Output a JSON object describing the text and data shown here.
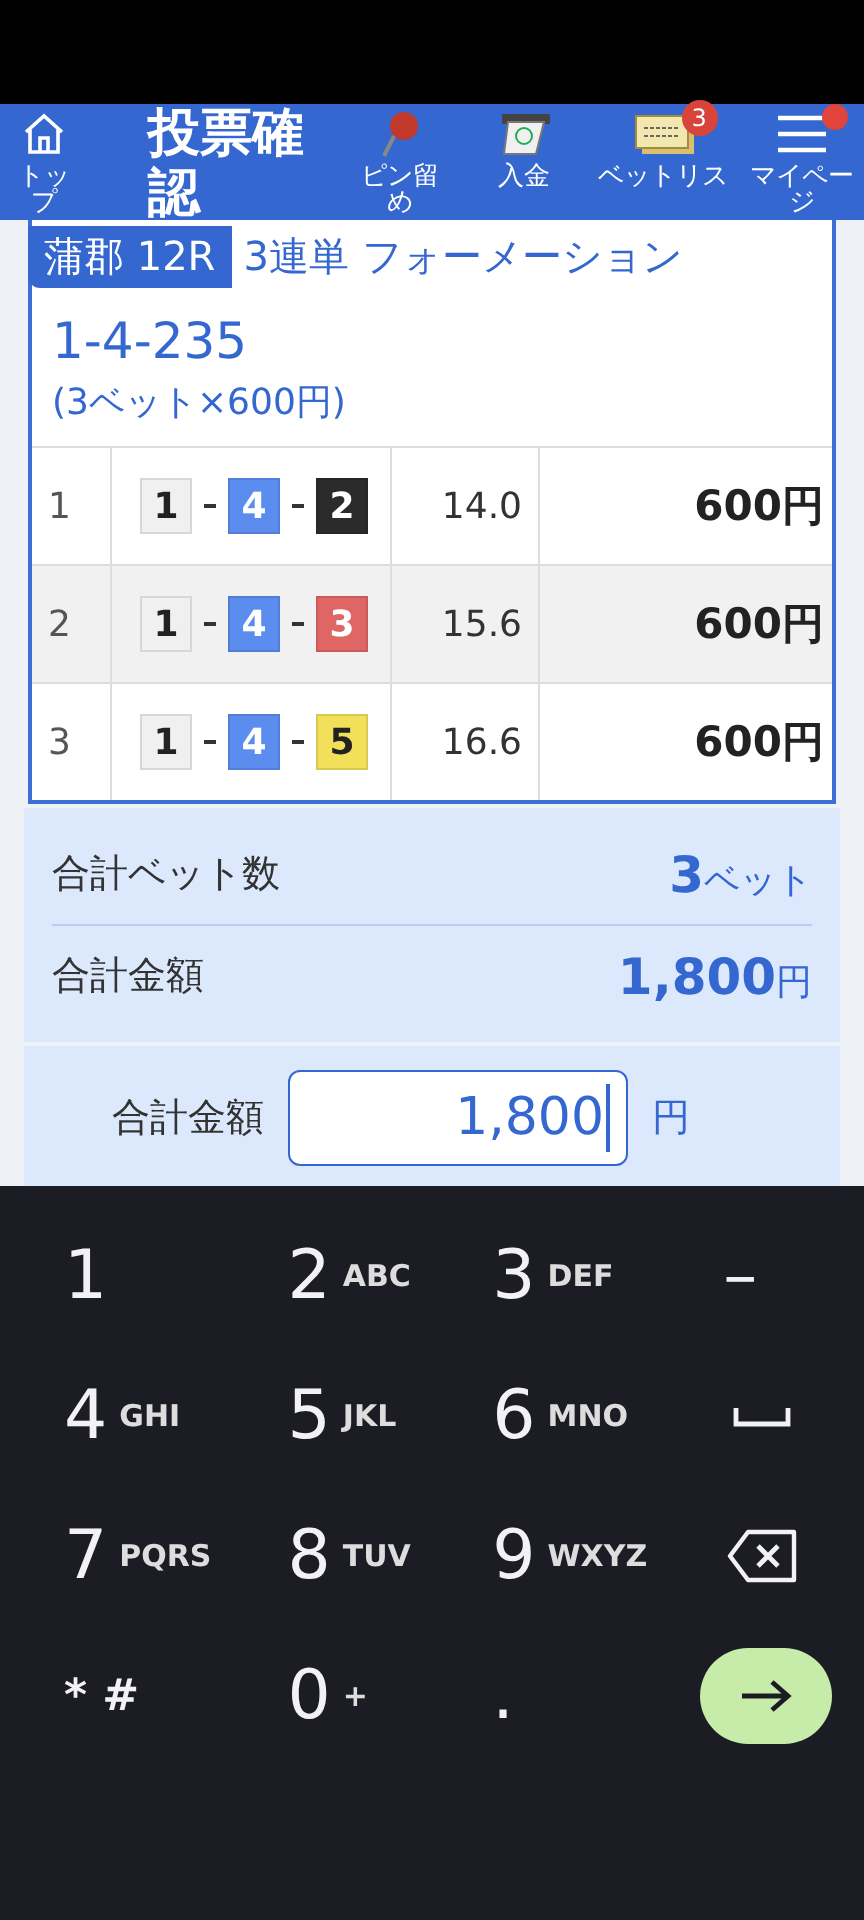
{
  "header": {
    "nav": [
      {
        "kind": "home",
        "label": "トップ"
      },
      {
        "kind": "title",
        "label": "投票確認"
      },
      {
        "kind": "pin",
        "label": "ピン留め"
      },
      {
        "kind": "deposit",
        "label": "入金"
      },
      {
        "kind": "betlist",
        "label": "ベットリス",
        "badge": "3"
      },
      {
        "kind": "menu",
        "label": "マイページ",
        "alert": true
      }
    ]
  },
  "ticket": {
    "venue": "蒲郡 12R",
    "bet_type": "3連単 フォーメーション",
    "combination": "1-4-235",
    "summary": "(3ベット×600円)",
    "rows": [
      {
        "index": "1",
        "boats": [
          {
            "number": "1",
            "color": "#f0f0f0"
          },
          {
            "number": "4",
            "color": "#5b8def"
          },
          {
            "number": "2",
            "color": "#2b2b2b"
          }
        ],
        "odds": "14.0",
        "amount": "600円"
      },
      {
        "index": "2",
        "boats": [
          {
            "number": "1",
            "color": "#f0f0f0"
          },
          {
            "number": "4",
            "color": "#5b8def"
          },
          {
            "number": "3",
            "color": "#e06666"
          }
        ],
        "odds": "15.6",
        "amount": "600円"
      },
      {
        "index": "3",
        "boats": [
          {
            "number": "1",
            "color": "#f0f0f0"
          },
          {
            "number": "4",
            "color": "#5b8def"
          },
          {
            "number": "5",
            "color": "#f2e05a"
          }
        ],
        "odds": "16.6",
        "amount": "600円"
      }
    ]
  },
  "totals": {
    "bet_count_label": "合計ベット数",
    "bet_count": "3",
    "bet_count_unit": "ベット",
    "total_label": "合計金額",
    "total": "1,800",
    "total_unit": "円"
  },
  "amount_input": {
    "label": "合計金額",
    "value": "1,800",
    "unit": "円"
  },
  "keyboard": {
    "keys": [
      {
        "kind": "digit",
        "main": "1"
      },
      {
        "kind": "digit",
        "main": "2",
        "sub": "ABC"
      },
      {
        "kind": "digit",
        "main": "3",
        "sub": "DEF"
      },
      {
        "kind": "digit",
        "main": "–"
      },
      {
        "kind": "digit",
        "main": "4",
        "sub": "GHI"
      },
      {
        "kind": "digit",
        "main": "5",
        "sub": "JKL"
      },
      {
        "kind": "digit",
        "main": "6",
        "sub": "MNO"
      },
      {
        "kind": "space"
      },
      {
        "kind": "digit",
        "main": "7",
        "sub": "PQRS"
      },
      {
        "kind": "digit",
        "main": "8",
        "sub": "TUV"
      },
      {
        "kind": "digit",
        "main": "9",
        "sub": "WXYZ"
      },
      {
        "kind": "backspace"
      },
      {
        "kind": "symbol",
        "main": "* #"
      },
      {
        "kind": "digit",
        "main": "0",
        "sub": "+"
      },
      {
        "kind": "digit",
        "main": "."
      },
      {
        "kind": "enter"
      }
    ]
  }
}
